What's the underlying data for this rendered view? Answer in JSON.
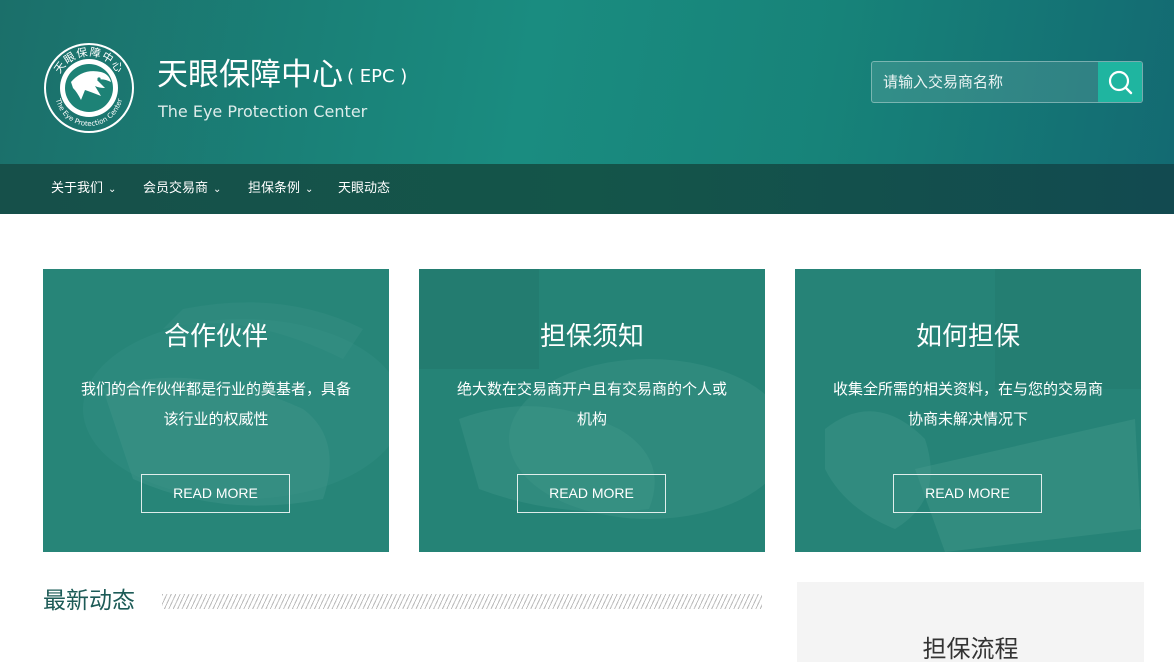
{
  "header": {
    "title": "天眼保障中心",
    "title_abbr": "( EPC )",
    "subtitle": "The Eye Protection Center",
    "logo": {
      "ring_text_top": "天眼保障中心",
      "ring_text_bottom": "The Eye Protection Center",
      "icon": "eagle-icon"
    },
    "search": {
      "placeholder": "请输入交易商名称",
      "value": "",
      "icon": "search-icon"
    }
  },
  "nav": {
    "items": [
      {
        "label": "关于我们",
        "has_dropdown": true
      },
      {
        "label": "会员交易商",
        "has_dropdown": true
      },
      {
        "label": "担保条例",
        "has_dropdown": true
      },
      {
        "label": "天眼动态",
        "has_dropdown": false
      }
    ]
  },
  "cards": [
    {
      "title": "合作伙伴",
      "text": "我们的合作伙伴都是行业的奠基者，具备该行业的权威性",
      "button": "READ MORE"
    },
    {
      "title": "担保须知",
      "text": "绝大数在交易商开户且有交易商的个人或机构",
      "button": "READ MORE"
    },
    {
      "title": "如何担保",
      "text": "收集全所需的相关资料，在与您的交易商协商未解决情况下",
      "button": "READ MORE"
    }
  ],
  "news": {
    "title": "最新动态"
  },
  "side": {
    "title": "担保流程"
  },
  "colors": {
    "header_start": "#1b6f6a",
    "header_mid": "#1a8c80",
    "header_end": "#136a72",
    "nav": "#145549",
    "accent": "#1fb5a0",
    "card_overlay": "#2a8a7e",
    "heading": "#1d5b57"
  }
}
